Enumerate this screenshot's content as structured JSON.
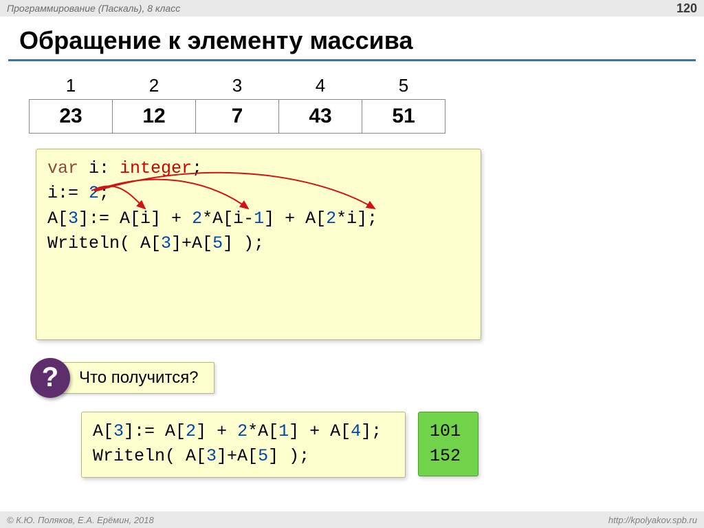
{
  "header": {
    "course": "Программирование (Паскаль), 8 класс",
    "page": "120"
  },
  "title": "Обращение к элементу массива",
  "array": {
    "indices": [
      "1",
      "2",
      "3",
      "4",
      "5"
    ],
    "values": [
      "23",
      "12",
      "7",
      "43",
      "51"
    ]
  },
  "code1": {
    "tokens": [
      {
        "t": "var",
        "c": "kw-mahog"
      },
      {
        "t": " i: "
      },
      {
        "t": "integer",
        "c": "kw-red"
      },
      {
        "t": ";"
      },
      {
        "t": "\n"
      },
      {
        "t": "i:= "
      },
      {
        "t": "2",
        "c": "kw-blue"
      },
      {
        "t": ";"
      },
      {
        "t": "\n"
      },
      {
        "t": "A["
      },
      {
        "t": "3",
        "c": "kw-blue"
      },
      {
        "t": "]:= A[i] + "
      },
      {
        "t": "2",
        "c": "kw-blue"
      },
      {
        "t": "*A[i-"
      },
      {
        "t": "1",
        "c": "kw-blue"
      },
      {
        "t": "] + A["
      },
      {
        "t": "2",
        "c": "kw-blue"
      },
      {
        "t": "*i];"
      },
      {
        "t": "\n"
      },
      {
        "t": "Writeln( A["
      },
      {
        "t": "3",
        "c": "kw-blue"
      },
      {
        "t": "]+A["
      },
      {
        "t": "5",
        "c": "kw-blue"
      },
      {
        "t": "] );"
      }
    ]
  },
  "question": {
    "mark": "?",
    "label": "Что получится?"
  },
  "code2": {
    "tokens": [
      {
        "t": "A["
      },
      {
        "t": "3",
        "c": "kw-blue"
      },
      {
        "t": "]:= A["
      },
      {
        "t": "2",
        "c": "kw-blue"
      },
      {
        "t": "] + "
      },
      {
        "t": "2",
        "c": "kw-blue"
      },
      {
        "t": "*A["
      },
      {
        "t": "1",
        "c": "kw-blue"
      },
      {
        "t": "] + A["
      },
      {
        "t": "4",
        "c": "kw-blue"
      },
      {
        "t": "];"
      },
      {
        "t": "\n"
      },
      {
        "t": "Writeln( A["
      },
      {
        "t": "3",
        "c": "kw-blue"
      },
      {
        "t": "]+A["
      },
      {
        "t": "5",
        "c": "kw-blue"
      },
      {
        "t": "] );"
      }
    ]
  },
  "answers": [
    "101",
    "152"
  ],
  "footer": {
    "author": "© К.Ю. Поляков, Е.А. Ерёмин, 2018",
    "url": "http://kpolyakov.spb.ru"
  }
}
